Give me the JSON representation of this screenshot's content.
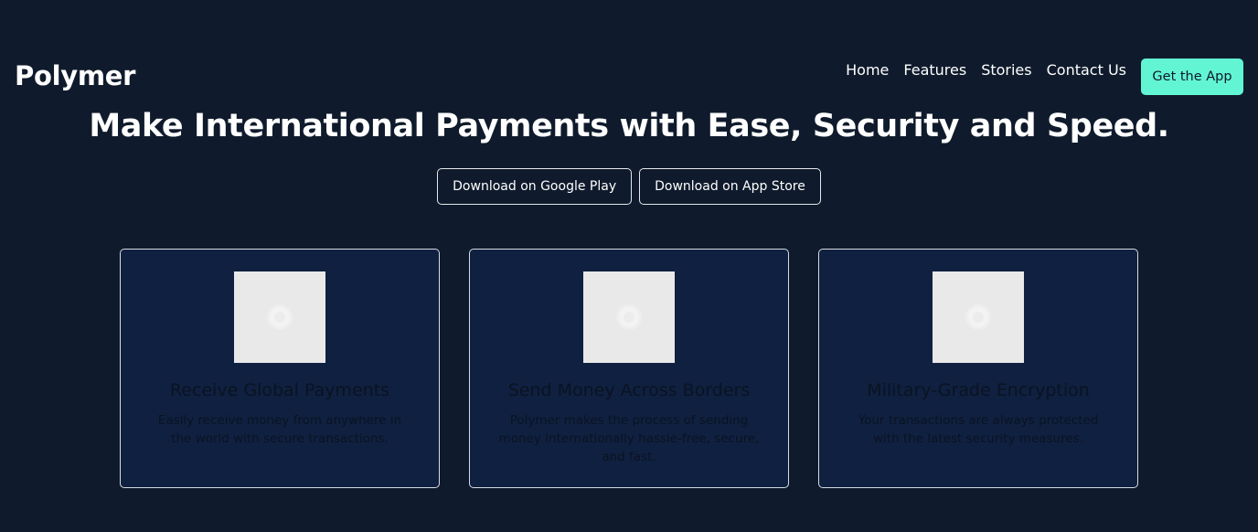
{
  "brand": {
    "name": "Polymer"
  },
  "nav": {
    "links": [
      "Home",
      "Features",
      "Stories",
      "Contact Us"
    ],
    "cta_label": "Get the App"
  },
  "hero": {
    "title": "Make International Payments with Ease, Security and Speed.",
    "buttons": [
      "Download on Google Play",
      "Download on App Store"
    ]
  },
  "features": [
    {
      "title": "Receive Global Payments",
      "text": "Easily receive money from anywhere in the world with secure transactions."
    },
    {
      "title": "Send Money Across Borders",
      "text": "Polymer makes the process of sending money internationally hassle-free, secure, and fast."
    },
    {
      "title": "Military-Grade Encryption",
      "text": "Your transactions are always protected with the latest security measures."
    }
  ],
  "colors": {
    "background": "#0f1b2c",
    "accent": "#62f5d4",
    "card_background": "#102040"
  }
}
